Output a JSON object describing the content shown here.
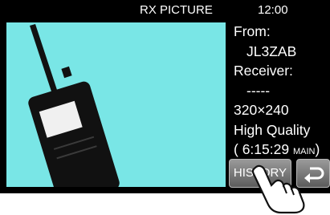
{
  "status_bar": {
    "title": "RX PICTURE",
    "time": "12:00"
  },
  "picture": {
    "background_color": "#79e6e6",
    "subject": "handheld-radio"
  },
  "info": {
    "from_label": "From:",
    "from_value": "JL3ZAB",
    "receiver_label": "Receiver:",
    "receiver_value": "-----",
    "resolution": "320×240",
    "quality": "High Quality",
    "time_prefix": "(  6:15:29",
    "time_band": "MAIN",
    "time_suffix": ")"
  },
  "buttons": {
    "history_label": "HISTORY",
    "back_icon": "return-arrow-icon"
  },
  "colors": {
    "screen_bg": "#000000",
    "button_gray": "#7a7a7a"
  }
}
